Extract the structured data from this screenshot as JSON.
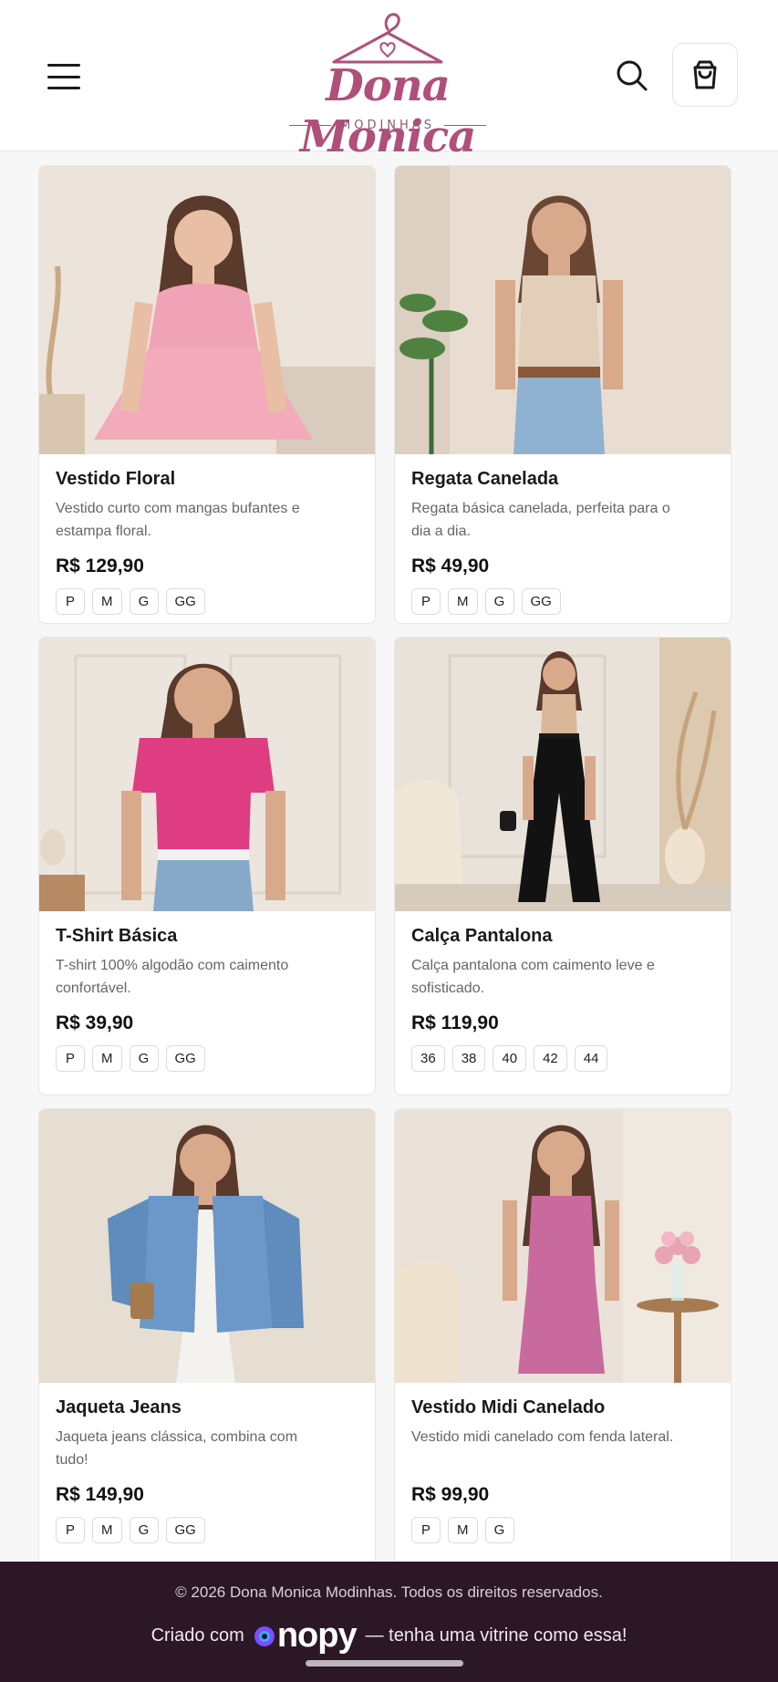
{
  "header": {
    "brand_name": "Dona Monica",
    "brand_sub": "MODINHAS",
    "icons": {
      "menu": "menu-icon",
      "search": "search-icon",
      "cart": "shopping-bag-icon"
    },
    "accent_color": "#b04f7a"
  },
  "products": [
    {
      "title": "Vestido Floral",
      "desc": "Vestido curto com mangas bufantes e estampa floral.",
      "price": "R$ 129,90",
      "sizes": [
        "P",
        "M",
        "G",
        "GG"
      ],
      "image": "woman-pink-floral-dress-photo"
    },
    {
      "title": "Regata Canelada",
      "desc": "Regata básica canelada, perfeita para o dia a dia.",
      "price": "R$ 49,90",
      "sizes": [
        "P",
        "M",
        "G",
        "GG"
      ],
      "image": "woman-beige-tank-top-jeans-photo"
    },
    {
      "title": "T-Shirt Básica",
      "desc": "T-shirt 100% algodão com caimento confortável.",
      "price": "R$ 39,90",
      "sizes": [
        "P",
        "M",
        "G",
        "GG"
      ],
      "image": "woman-pink-tshirt-photo"
    },
    {
      "title": "Calça Pantalona",
      "desc": "Calça pantalona com caimento leve e sofisticado.",
      "price": "R$ 119,90",
      "sizes": [
        "36",
        "38",
        "40",
        "42",
        "44"
      ],
      "image": "woman-black-wide-pants-photo"
    },
    {
      "title": "Jaqueta Jeans",
      "desc": "Jaqueta jeans clássica, combina com tudo!",
      "price": "R$ 149,90",
      "sizes": [
        "P",
        "M",
        "G",
        "GG"
      ],
      "image": "woman-denim-jacket-photo"
    },
    {
      "title": "Vestido Midi Canelado",
      "desc": "Vestido midi canelado com fenda lateral.",
      "price": "R$ 99,90",
      "sizes": [
        "P",
        "M",
        "G"
      ],
      "image": "woman-pink-midi-dress-photo"
    }
  ],
  "footer": {
    "copyright": "© 2026 Dona Monica Modinhas. Todos os direitos reservados.",
    "credit_prefix": "Criado com",
    "credit_brand": "nopy",
    "credit_suffix": "— tenha uma vitrine como essa!"
  }
}
